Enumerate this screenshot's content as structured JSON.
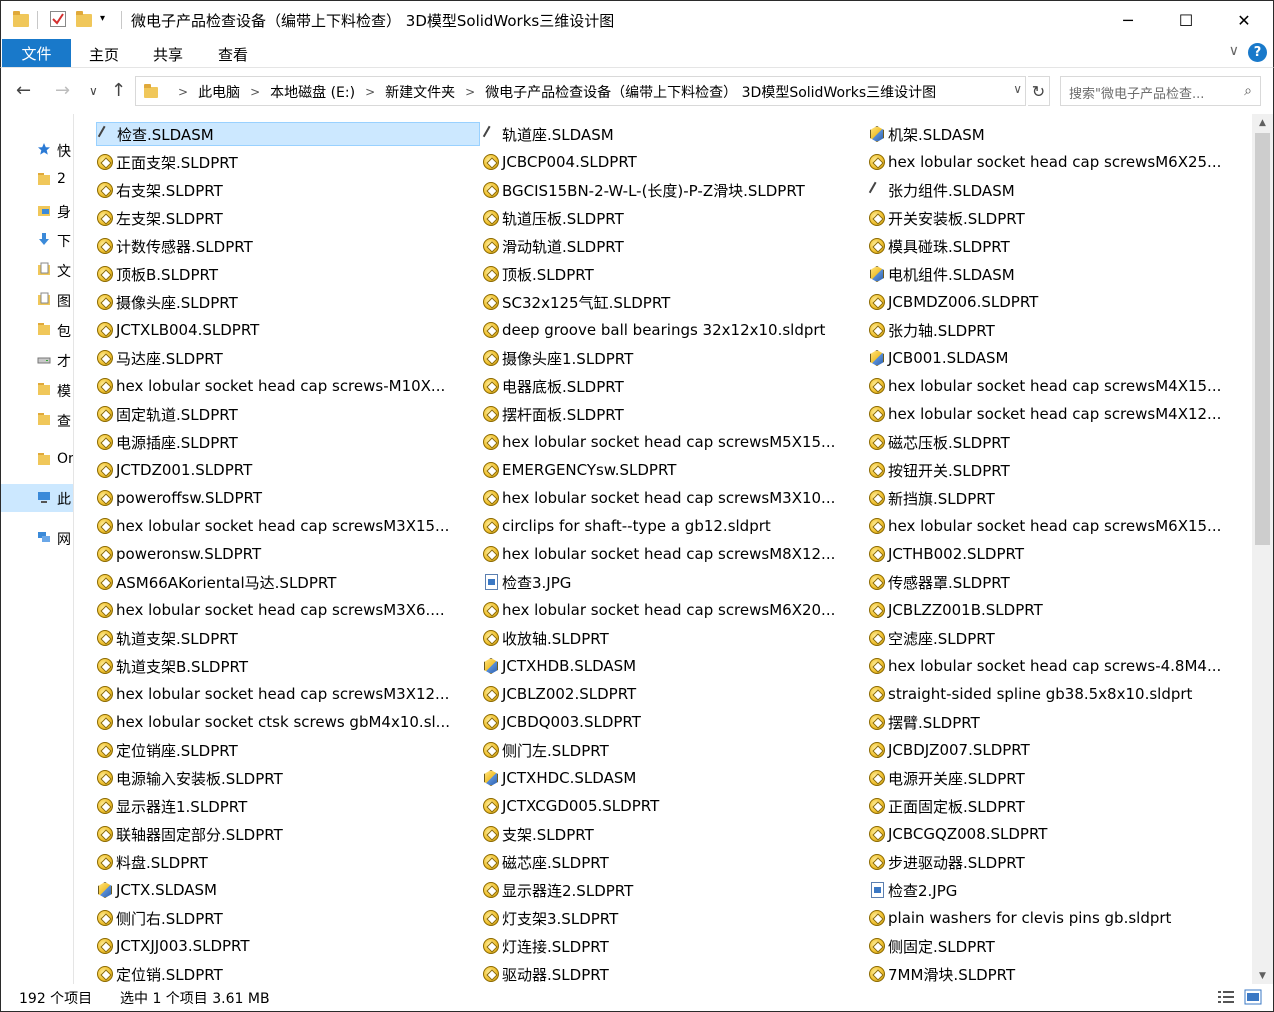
{
  "window": {
    "title": "微电子产品检查设备（编带上下料检查） 3D模型SolidWorks三维设计图",
    "minimize_glyph": "─",
    "maximize_glyph": "☐",
    "close_glyph": "✕"
  },
  "ribbon": {
    "file_tab": "文件",
    "tabs": [
      "主页",
      "共享",
      "查看"
    ],
    "expand_glyph": "∨",
    "help_glyph": "?"
  },
  "address": {
    "crumbs": [
      "此电脑",
      "本地磁盘 (E:)",
      "新建文件夹",
      "微电子产品检查设备（编带上下料检查） 3D模型SolidWorks三维设计图"
    ],
    "search_placeholder": "搜索\"微电子产品检查...",
    "back_glyph": "←",
    "forward_glyph": "→",
    "recent_glyph": "∨",
    "up_glyph": "↑",
    "refresh_glyph": "↻",
    "dropdown_glyph": "∨",
    "search_glyph": "⌕",
    "crumb_sep": ">"
  },
  "sidebar": {
    "items": [
      {
        "label": "快",
        "icon": "star-icon",
        "color": "#2a7ad5"
      },
      {
        "label": "2",
        "icon": "folder-icon",
        "color": "#f0c75a"
      },
      {
        "label": "身",
        "icon": "desktop-folder-icon",
        "color": "#3b8ad9"
      },
      {
        "label": "下",
        "icon": "download-icon",
        "color": "#3b8ad9"
      },
      {
        "label": "文",
        "icon": "document-icon",
        "color": "#f0c75a"
      },
      {
        "label": "图",
        "icon": "pictures-icon",
        "color": "#f0c75a"
      },
      {
        "label": "包",
        "icon": "folder-icon",
        "color": "#f0c75a"
      },
      {
        "label": "才",
        "icon": "drive-icon",
        "color": "#888888"
      },
      {
        "label": "模",
        "icon": "folder-icon",
        "color": "#f0c75a"
      },
      {
        "label": "查",
        "icon": "folder-icon",
        "color": "#f0c75a"
      },
      {
        "label": "On",
        "icon": "folder-icon",
        "color": "#f0c75a"
      },
      {
        "label": "此",
        "icon": "pc-icon",
        "color": "#3b8ad9"
      },
      {
        "label": "网",
        "icon": "network-icon",
        "color": "#3b8ad9"
      }
    ]
  },
  "files": {
    "columns": [
      [
        {
          "name": "检查.SLDASM",
          "type": "thumb",
          "selected": true
        },
        {
          "name": "正面支架.SLDPRT",
          "type": "part"
        },
        {
          "name": "右支架.SLDPRT",
          "type": "part"
        },
        {
          "name": "左支架.SLDPRT",
          "type": "part"
        },
        {
          "name": "计数传感器.SLDPRT",
          "type": "part"
        },
        {
          "name": "顶板B.SLDPRT",
          "type": "part"
        },
        {
          "name": "摄像头座.SLDPRT",
          "type": "part"
        },
        {
          "name": "JCTXLB004.SLDPRT",
          "type": "part"
        },
        {
          "name": "马达座.SLDPRT",
          "type": "part"
        },
        {
          "name": "hex lobular socket head cap screws-M10X...",
          "type": "part"
        },
        {
          "name": "固定轨道.SLDPRT",
          "type": "part"
        },
        {
          "name": "电源插座.SLDPRT",
          "type": "part"
        },
        {
          "name": "JCTDZ001.SLDPRT",
          "type": "part"
        },
        {
          "name": "poweroffsw.SLDPRT",
          "type": "part"
        },
        {
          "name": "hex lobular socket head cap screwsM3X15...",
          "type": "part"
        },
        {
          "name": "poweronsw.SLDPRT",
          "type": "part"
        },
        {
          "name": "ASM66AKoriental马达.SLDPRT",
          "type": "part"
        },
        {
          "name": "hex lobular socket head cap screwsM3X6....",
          "type": "part"
        },
        {
          "name": "轨道支架.SLDPRT",
          "type": "part"
        },
        {
          "name": "轨道支架B.SLDPRT",
          "type": "part"
        },
        {
          "name": "hex lobular socket head cap screwsM3X12...",
          "type": "part"
        },
        {
          "name": "hex lobular socket ctsk screws gbM4x10.sl...",
          "type": "part"
        },
        {
          "name": "定位销座.SLDPRT",
          "type": "part"
        },
        {
          "name": "电源输入安装板.SLDPRT",
          "type": "part"
        },
        {
          "name": "显示器连1.SLDPRT",
          "type": "part"
        },
        {
          "name": "联轴器固定部分.SLDPRT",
          "type": "part"
        },
        {
          "name": "料盘.SLDPRT",
          "type": "part"
        },
        {
          "name": "JCTX.SLDASM",
          "type": "asm"
        },
        {
          "name": "侧门右.SLDPRT",
          "type": "part"
        },
        {
          "name": "JCTXJJ003.SLDPRT",
          "type": "part"
        },
        {
          "name": "定位销.SLDPRT",
          "type": "part"
        }
      ],
      [
        {
          "name": "轨道座.SLDASM",
          "type": "thumb"
        },
        {
          "name": "JCBCP004.SLDPRT",
          "type": "part"
        },
        {
          "name": "BGCIS15BN-2-W-L-(长度)-P-Z滑块.SLDPRT",
          "type": "part"
        },
        {
          "name": "轨道压板.SLDPRT",
          "type": "part"
        },
        {
          "name": "滑动轨道.SLDPRT",
          "type": "part"
        },
        {
          "name": "顶板.SLDPRT",
          "type": "part"
        },
        {
          "name": "SC32x125气缸.SLDPRT",
          "type": "part"
        },
        {
          "name": "deep groove ball bearings 32x12x10.sldprt",
          "type": "part"
        },
        {
          "name": "摄像头座1.SLDPRT",
          "type": "part"
        },
        {
          "name": "电器底板.SLDPRT",
          "type": "part"
        },
        {
          "name": "摆杆面板.SLDPRT",
          "type": "part"
        },
        {
          "name": "hex lobular socket head cap screwsM5X15...",
          "type": "part"
        },
        {
          "name": "EMERGENCYsw.SLDPRT",
          "type": "part"
        },
        {
          "name": "hex lobular socket head cap screwsM3X10...",
          "type": "part"
        },
        {
          "name": "circlips for shaft--type a gb12.sldprt",
          "type": "part"
        },
        {
          "name": "hex lobular socket head cap screwsM8X12...",
          "type": "part"
        },
        {
          "name": "检查3.JPG",
          "type": "jpg"
        },
        {
          "name": "hex lobular socket head cap screwsM6X20...",
          "type": "part"
        },
        {
          "name": "收放轴.SLDPRT",
          "type": "part"
        },
        {
          "name": "JCTXHDB.SLDASM",
          "type": "asm"
        },
        {
          "name": "JCBLZ002.SLDPRT",
          "type": "part"
        },
        {
          "name": "JCBDQ003.SLDPRT",
          "type": "part"
        },
        {
          "name": "侧门左.SLDPRT",
          "type": "part"
        },
        {
          "name": "JCTXHDC.SLDASM",
          "type": "asm"
        },
        {
          "name": "JCTXCGD005.SLDPRT",
          "type": "part"
        },
        {
          "name": "支架.SLDPRT",
          "type": "part"
        },
        {
          "name": "磁芯座.SLDPRT",
          "type": "part"
        },
        {
          "name": "显示器连2.SLDPRT",
          "type": "part"
        },
        {
          "name": "灯支架3.SLDPRT",
          "type": "part"
        },
        {
          "name": "灯连接.SLDPRT",
          "type": "part"
        },
        {
          "name": "驱动器.SLDPRT",
          "type": "part"
        }
      ],
      [
        {
          "name": "机架.SLDASM",
          "type": "asm"
        },
        {
          "name": "hex lobular socket head cap screwsM6X25...",
          "type": "part"
        },
        {
          "name": "张力组件.SLDASM",
          "type": "thumb"
        },
        {
          "name": "开关安装板.SLDPRT",
          "type": "part"
        },
        {
          "name": "模具碰珠.SLDPRT",
          "type": "part"
        },
        {
          "name": "电机组件.SLDASM",
          "type": "asm"
        },
        {
          "name": "JCBMDZ006.SLDPRT",
          "type": "part"
        },
        {
          "name": "张力轴.SLDPRT",
          "type": "part"
        },
        {
          "name": "JCB001.SLDASM",
          "type": "asm"
        },
        {
          "name": "hex lobular socket head cap screwsM4X15...",
          "type": "part"
        },
        {
          "name": "hex lobular socket head cap screwsM4X12...",
          "type": "part"
        },
        {
          "name": "磁芯压板.SLDPRT",
          "type": "part"
        },
        {
          "name": "按钮开关.SLDPRT",
          "type": "part"
        },
        {
          "name": "新挡旗.SLDPRT",
          "type": "part"
        },
        {
          "name": "hex lobular socket head cap screwsM6X15...",
          "type": "part"
        },
        {
          "name": "JCTHB002.SLDPRT",
          "type": "part"
        },
        {
          "name": "传感器罩.SLDPRT",
          "type": "part"
        },
        {
          "name": "JCBLZZ001B.SLDPRT",
          "type": "part"
        },
        {
          "name": "空滤座.SLDPRT",
          "type": "part"
        },
        {
          "name": "hex lobular socket head cap screws-4.8M4...",
          "type": "part"
        },
        {
          "name": "straight-sided spline gb38.5x8x10.sldprt",
          "type": "part"
        },
        {
          "name": "摆臂.SLDPRT",
          "type": "part"
        },
        {
          "name": "JCBDJZ007.SLDPRT",
          "type": "part"
        },
        {
          "name": "电源开关座.SLDPRT",
          "type": "part"
        },
        {
          "name": "正面固定板.SLDPRT",
          "type": "part"
        },
        {
          "name": "JCBCGQZ008.SLDPRT",
          "type": "part"
        },
        {
          "name": "步进驱动器.SLDPRT",
          "type": "part"
        },
        {
          "name": "检查2.JPG",
          "type": "jpg"
        },
        {
          "name": "plain washers for clevis pins gb.sldprt",
          "type": "part"
        },
        {
          "name": "侧固定.SLDPRT",
          "type": "part"
        },
        {
          "name": "7MM滑块.SLDPRT",
          "type": "part"
        }
      ]
    ]
  },
  "status": {
    "count": "192 个项目",
    "selection": "选中 1 个项目  3.61 MB"
  },
  "colors": {
    "accent": "#1979ca",
    "selection_bg": "#cce8ff",
    "selection_border": "#99d1ff",
    "folder": "#f0c75a"
  }
}
